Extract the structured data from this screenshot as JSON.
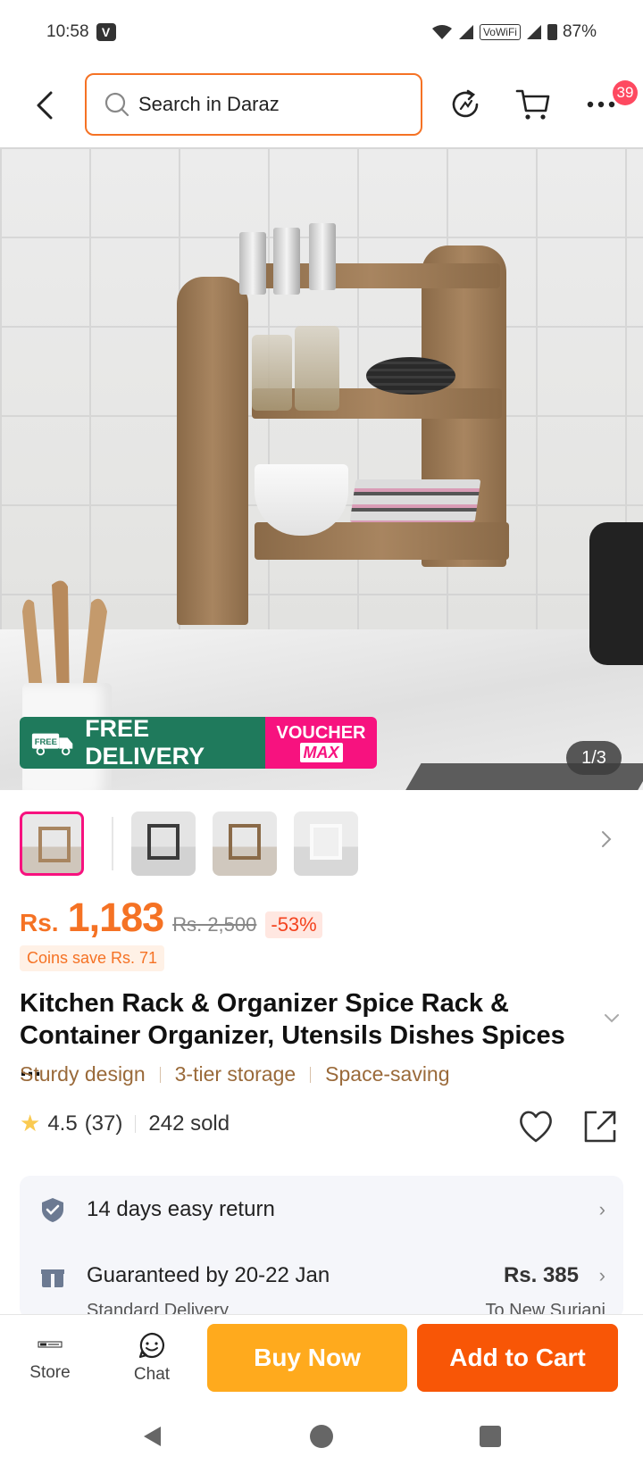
{
  "status_bar": {
    "time": "10:58",
    "carrier_badge": "V",
    "wifi_label": "VoWiFi",
    "battery": "87%"
  },
  "nav": {
    "search_placeholder": "Search in Daraz",
    "more_badge": "39"
  },
  "hero": {
    "promo_free_delivery": "FREE DELIVERY",
    "promo_free_tag": "FREE",
    "promo_voucher_line1": "VOUCHER",
    "promo_voucher_line2": "MAX",
    "image_counter": "1/3"
  },
  "price": {
    "currency": "Rs.",
    "current": "1,183",
    "original": "Rs. 2,500",
    "discount": "-53%",
    "coins": "Coins save Rs. 71"
  },
  "product": {
    "title": "Kitchen Rack & Organizer Spice Rack & Container Organizer, Utensils Dishes Spices ...",
    "features": [
      "Sturdy design",
      "3-tier storage",
      "Space-saving"
    ],
    "rating": "4.5",
    "rating_count": "(37)",
    "sold": "242 sold"
  },
  "service": {
    "return_text": "14 days easy return",
    "delivery_text": "Guaranteed by 20-22 Jan",
    "delivery_price": "Rs. 385",
    "delivery_sub": "Standard Delivery",
    "delivery_location": "To New Surjani"
  },
  "bottom_bar": {
    "store_label": "Store",
    "chat_label": "Chat",
    "buy_now": "Buy Now",
    "add_to_cart": "Add to Cart"
  },
  "colors": {
    "brand_orange": "#f85606",
    "buy_now_yellow": "#ffaa1d",
    "price_orange": "#f57224",
    "badge_pink": "#f7127f",
    "promo_green": "#1f7a5c"
  },
  "icons": [
    "back-icon",
    "search-icon",
    "refresh-icon",
    "cart-icon",
    "more-icon",
    "truck-icon",
    "chevron-right-icon",
    "chevron-down-icon",
    "star-icon",
    "heart-icon",
    "share-icon",
    "shield-check-icon",
    "gift-box-icon",
    "store-icon",
    "chat-icon"
  ]
}
